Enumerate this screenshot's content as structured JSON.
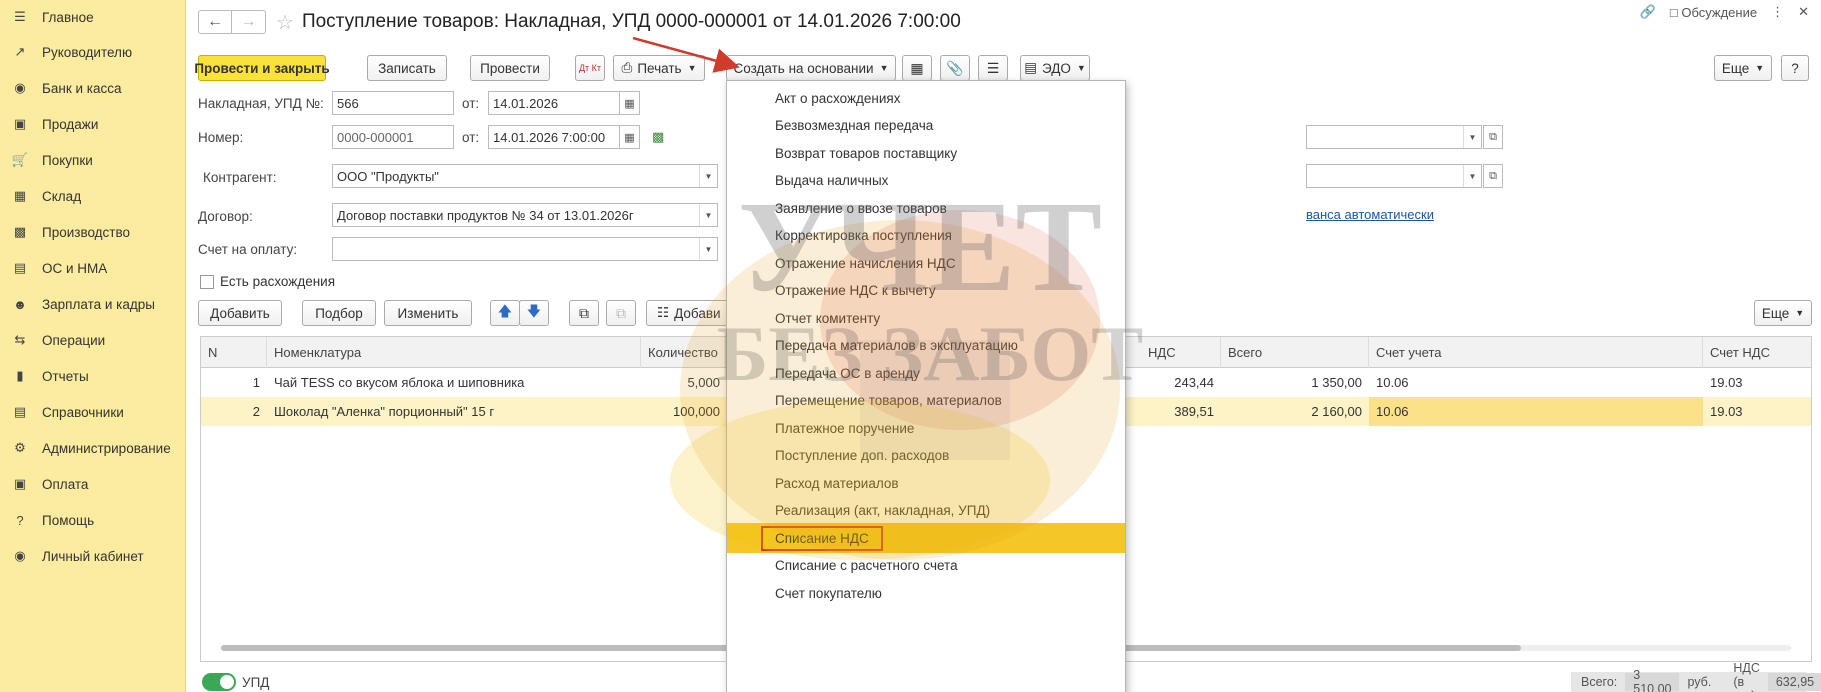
{
  "sidebar": {
    "items": [
      {
        "label": "Главное",
        "icon": "menu-icon"
      },
      {
        "label": "Руководителю",
        "icon": "trend-icon"
      },
      {
        "label": "Банк и касса",
        "icon": "coin-icon"
      },
      {
        "label": "Продажи",
        "icon": "bag-icon"
      },
      {
        "label": "Покупки",
        "icon": "cart-icon"
      },
      {
        "label": "Склад",
        "icon": "grid-icon"
      },
      {
        "label": "Производство",
        "icon": "factory-icon"
      },
      {
        "label": "ОС и НМА",
        "icon": "truck-icon"
      },
      {
        "label": "Зарплата и кадры",
        "icon": "person-icon"
      },
      {
        "label": "Операции",
        "icon": "dtkt-icon"
      },
      {
        "label": "Отчеты",
        "icon": "chart-icon"
      },
      {
        "label": "Справочники",
        "icon": "book-icon"
      },
      {
        "label": "Администрирование",
        "icon": "gear-icon"
      },
      {
        "label": "Оплата",
        "icon": "wallet-icon"
      },
      {
        "label": "Помощь",
        "icon": "question-icon"
      },
      {
        "label": "Личный кабинет",
        "icon": "user-circle-icon"
      }
    ]
  },
  "header": {
    "title": "Поступление товаров: Накладная, УПД 0000-000001 от 14.01.2026 7:00:00",
    "discussion": "Обсуждение"
  },
  "toolbar": {
    "post_close": "Провести и закрыть",
    "save": "Записать",
    "post": "Провести",
    "dtkt": "Дт Кт",
    "print": "Печать",
    "create_based": "Создать на основании",
    "edo": "ЭДО",
    "more": "Еще",
    "help": "?"
  },
  "form": {
    "invoice_label": "Накладная, УПД №:",
    "invoice_no": "566",
    "from_label": "от:",
    "invoice_date": "14.01.2026",
    "number_label": "Номер:",
    "number": "0000-000001",
    "number_date": "14.01.2026  7:00:00",
    "contractor_label": "Контрагент:",
    "contractor": "ООО \"Продукты\"",
    "contract_label": "Договор:",
    "contract": "Договор поставки продуктов № 34 от 13.01.2026г",
    "account_label": "Счет на оплату:",
    "account": "",
    "advance_link": "ванса автоматически",
    "discrepancy_label": "Есть расхождения"
  },
  "table_toolbar": {
    "add": "Добавить",
    "select": "Подбор",
    "change": "Изменить",
    "add2": "Добави",
    "more": "Еще"
  },
  "table": {
    "columns": [
      "N",
      "Номенклатура",
      "Количество",
      "НДС",
      "Всего",
      "Счет учета",
      "Счет НДС"
    ],
    "rows": [
      {
        "n": "1",
        "item": "Чай TESS со вкусом яблока и шиповника",
        "qty": "5,000",
        "vat": "243,44",
        "total": "1 350,00",
        "acc": "10.06",
        "vat_acc": "19.03"
      },
      {
        "n": "2",
        "item": "Шоколад \"Аленка\" порционный\" 15 г",
        "qty": "100,000",
        "vat": "389,51",
        "total": "2 160,00",
        "acc": "10.06",
        "vat_acc": "19.03"
      }
    ]
  },
  "footer": {
    "upd_label": "УПД",
    "total_label": "Всего:",
    "total_value": "3 510,00",
    "currency": "руб.",
    "vat_label": "НДС (в т.ч.):",
    "vat_value": "632,95"
  },
  "menu": {
    "items": [
      "Акт о расхождениях",
      "Безвозмездная передача",
      "Возврат товаров поставщику",
      "Выдача наличных",
      "Заявление о ввозе товаров",
      "Корректировка поступления",
      "Отражение начисления НДС",
      "Отражение НДС к вычету",
      "Отчет комитенту",
      "Передача материалов в эксплуатацию",
      "Передача ОС в аренду",
      "Перемещение товаров, материалов",
      "Платежное поручение",
      "Поступление доп. расходов",
      "Расход материалов",
      "Реализация (акт, накладная, УПД)",
      "Списание НДС",
      "Списание с расчетного счета",
      "Счет покупателю"
    ],
    "active_index": 16
  },
  "watermark": {
    "line1": "УЧЕТ",
    "line2": "БЕЗ ЗАБОТ"
  },
  "colors": {
    "sidebar": "#fbeca0",
    "primary": "#fbe23a",
    "highlight": "#f5c627",
    "arrow": "#d13b2c"
  }
}
